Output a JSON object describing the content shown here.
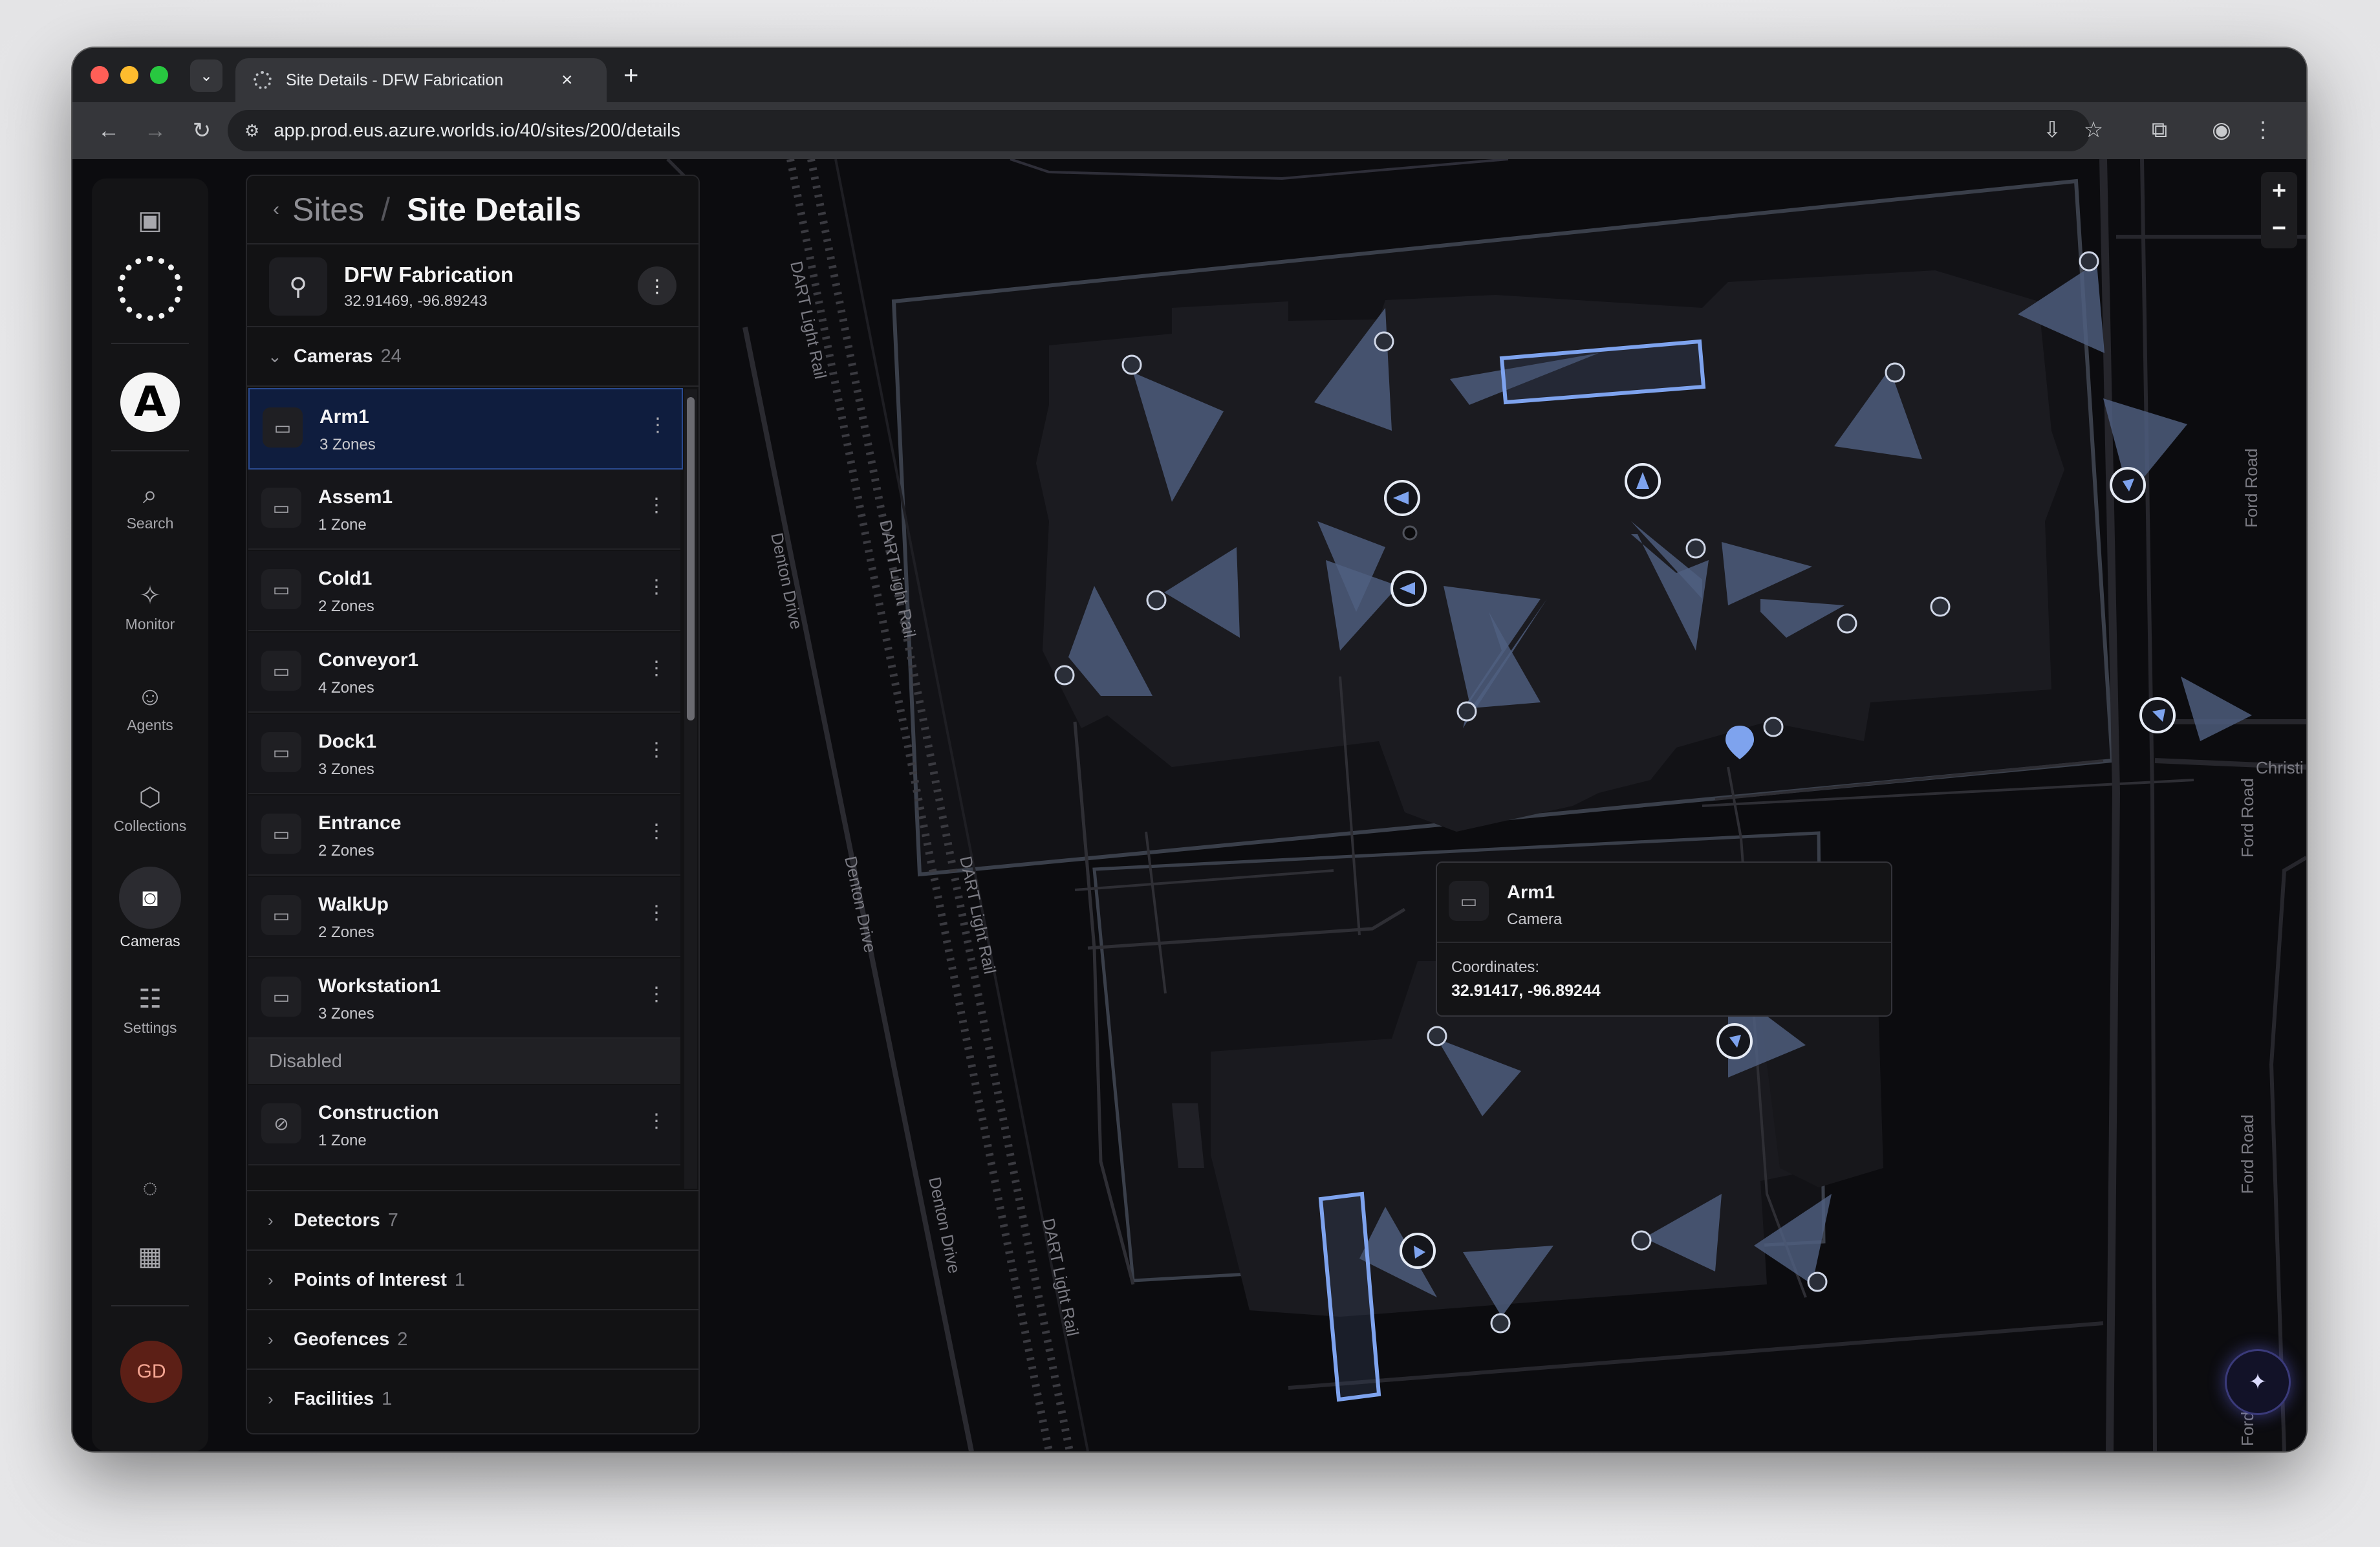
{
  "browser": {
    "tab_title": "Site Details - DFW Fabrication",
    "url": "app.prod.eus.azure.worlds.io/40/sites/200/details"
  },
  "rail": {
    "items": [
      {
        "label": "Search",
        "icon": "search-icon"
      },
      {
        "label": "Monitor",
        "icon": "monitor-icon"
      },
      {
        "label": "Agents",
        "icon": "agents-icon"
      },
      {
        "label": "Collections",
        "icon": "collections-icon"
      },
      {
        "label": "Cameras",
        "icon": "cameras-icon"
      },
      {
        "label": "Settings",
        "icon": "settings-icon"
      }
    ],
    "avatar_initials": "GD"
  },
  "panel": {
    "breadcrumb_parent": "Sites",
    "breadcrumb_separator": "/",
    "breadcrumb_current": "Site Details",
    "site_name": "DFW Fabrication",
    "site_coords": "32.91469, -96.89243",
    "sections": {
      "cameras": {
        "label": "Cameras",
        "count": "24"
      },
      "detectors": {
        "label": "Detectors",
        "count": "7"
      },
      "poi": {
        "label": "Points of Interest",
        "count": "1"
      },
      "geofences": {
        "label": "Geofences",
        "count": "2"
      },
      "facilities": {
        "label": "Facilities",
        "count": "1"
      }
    },
    "cameras": [
      {
        "name": "Arm1",
        "zones": "3 Zones"
      },
      {
        "name": "Assem1",
        "zones": "1 Zone"
      },
      {
        "name": "Cold1",
        "zones": "2 Zones"
      },
      {
        "name": "Conveyor1",
        "zones": "4 Zones"
      },
      {
        "name": "Dock1",
        "zones": "3 Zones"
      },
      {
        "name": "Entrance",
        "zones": "2 Zones"
      },
      {
        "name": "WalkUp",
        "zones": "2 Zones"
      },
      {
        "name": "Workstation1",
        "zones": "3 Zones"
      }
    ],
    "disabled_label": "Disabled",
    "disabled_cameras": [
      {
        "name": "Construction",
        "zones": "1 Zone"
      }
    ]
  },
  "map": {
    "labels": {
      "dart1": "DART Light Rail",
      "dart2": "DART Light Rail",
      "dart3": "DART Light Rail",
      "dart4": "DART Light Rail",
      "denton1": "Denton Drive",
      "denton2": "Denton Drive",
      "denton3": "Denton Drive",
      "ford1": "Ford Road",
      "ford2": "Ford Road",
      "ford3": "Ford Road",
      "ford4": "Ford Road",
      "christi": "Christi"
    },
    "popup": {
      "name": "Arm1",
      "type": "Camera",
      "coord_label": "Coordinates:",
      "coords": "32.91417, -96.89244"
    },
    "colors": {
      "camera_cone": "#5b6d8f",
      "selected_outline": "#7ea3ee",
      "marker": "#7ea3ee"
    }
  }
}
